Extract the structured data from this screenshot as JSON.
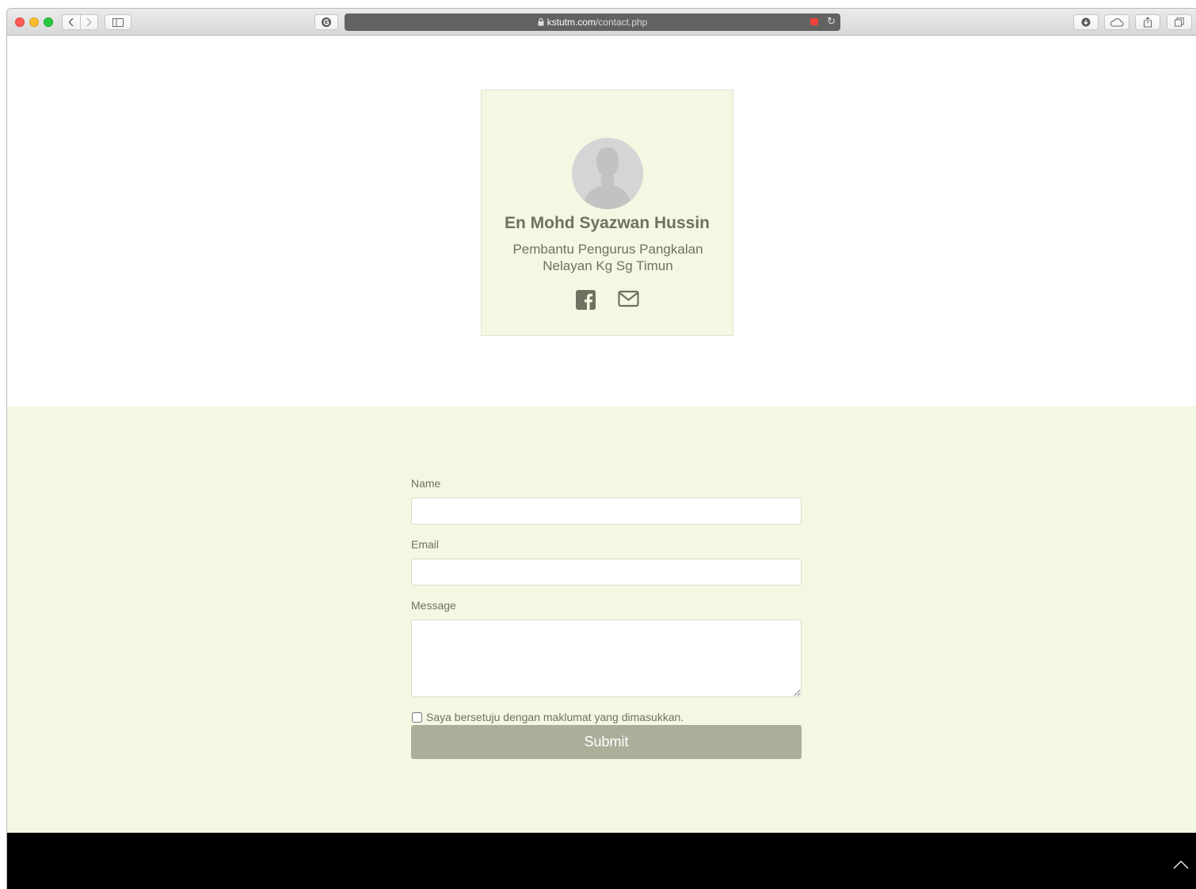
{
  "browser": {
    "url_host": "kstutm.com",
    "url_path": "/contact.php",
    "lock_icon": "lock-icon",
    "reload_icon": "reload-icon"
  },
  "profile": {
    "name": "En Mohd Syazwan Hussin",
    "role": "Pembantu Pengurus Pangkalan Nelayan Kg Sg Timun",
    "avatar_icon": "avatar-placeholder-icon",
    "social_icons": [
      "facebook-icon",
      "mail-icon"
    ]
  },
  "contact_form": {
    "name_label": "Name",
    "name_value": "",
    "email_label": "Email",
    "email_value": "",
    "message_label": "Message",
    "message_value": "",
    "agree_label": "Saya bersetuju dengan maklumat yang dimasukkan.",
    "agree_checked": false,
    "submit_label": "Submit"
  },
  "footer": {
    "back_to_top_icon": "chevron-up-icon"
  },
  "colors": {
    "card_background": "#f3f8e2",
    "text_muted": "#6d7360",
    "submit_background": "#a9af99",
    "footer_background": "#000000"
  }
}
